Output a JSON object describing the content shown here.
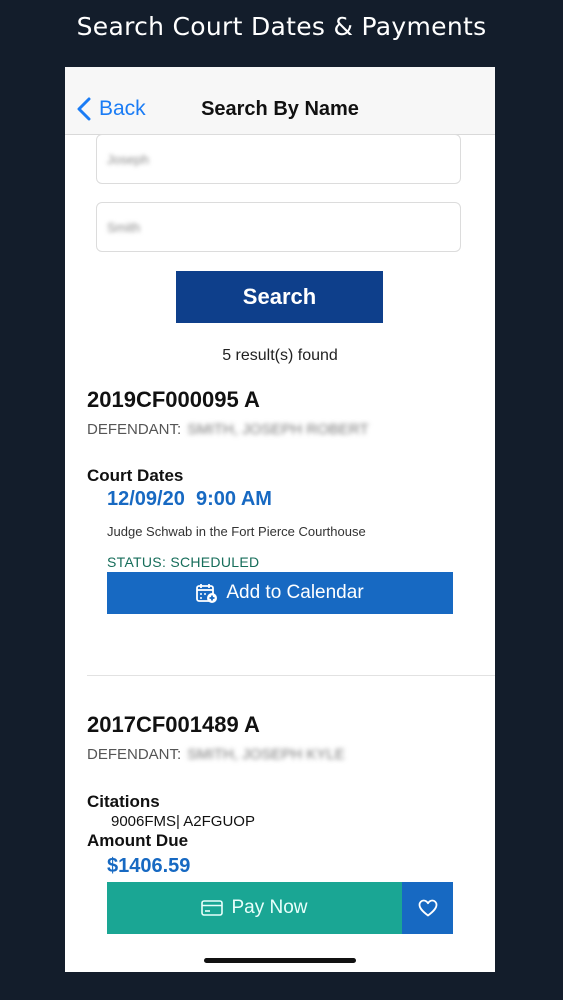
{
  "promo": {
    "title": "Search Court Dates & Payments"
  },
  "navbar": {
    "back_label": "Back",
    "title": "Search By Name"
  },
  "search": {
    "first_name_value": "Joseph",
    "last_name_value": "Smith",
    "button_label": "Search",
    "results_text": "5 result(s) found"
  },
  "results": [
    {
      "case_number": "2019CF000095 A",
      "defendant_label": "DEFENDANT:",
      "defendant_name": "SMITH, JOSEPH ROBERT",
      "section_title": "Court Dates",
      "date": "12/09/20",
      "time": "9:00 AM",
      "location": "Judge Schwab in the Fort Pierce Courthouse",
      "status": "STATUS: SCHEDULED",
      "action_label": "Add to Calendar"
    },
    {
      "case_number": "2017CF001489 A",
      "defendant_label": "DEFENDANT:",
      "defendant_name": "SMITH, JOSEPH KYLE",
      "citations_title": "Citations",
      "citations": "9006FMS| A2FGUOP",
      "amount_title": "Amount Due",
      "amount": "$1406.59",
      "pay_label": "Pay Now"
    }
  ],
  "colors": {
    "background": "#131d2b",
    "primary_blue": "#1769c2",
    "navy_button": "#0e3f8b",
    "teal": "#1aa694",
    "status_green": "#166d5a",
    "ios_link": "#1a7cf5"
  }
}
